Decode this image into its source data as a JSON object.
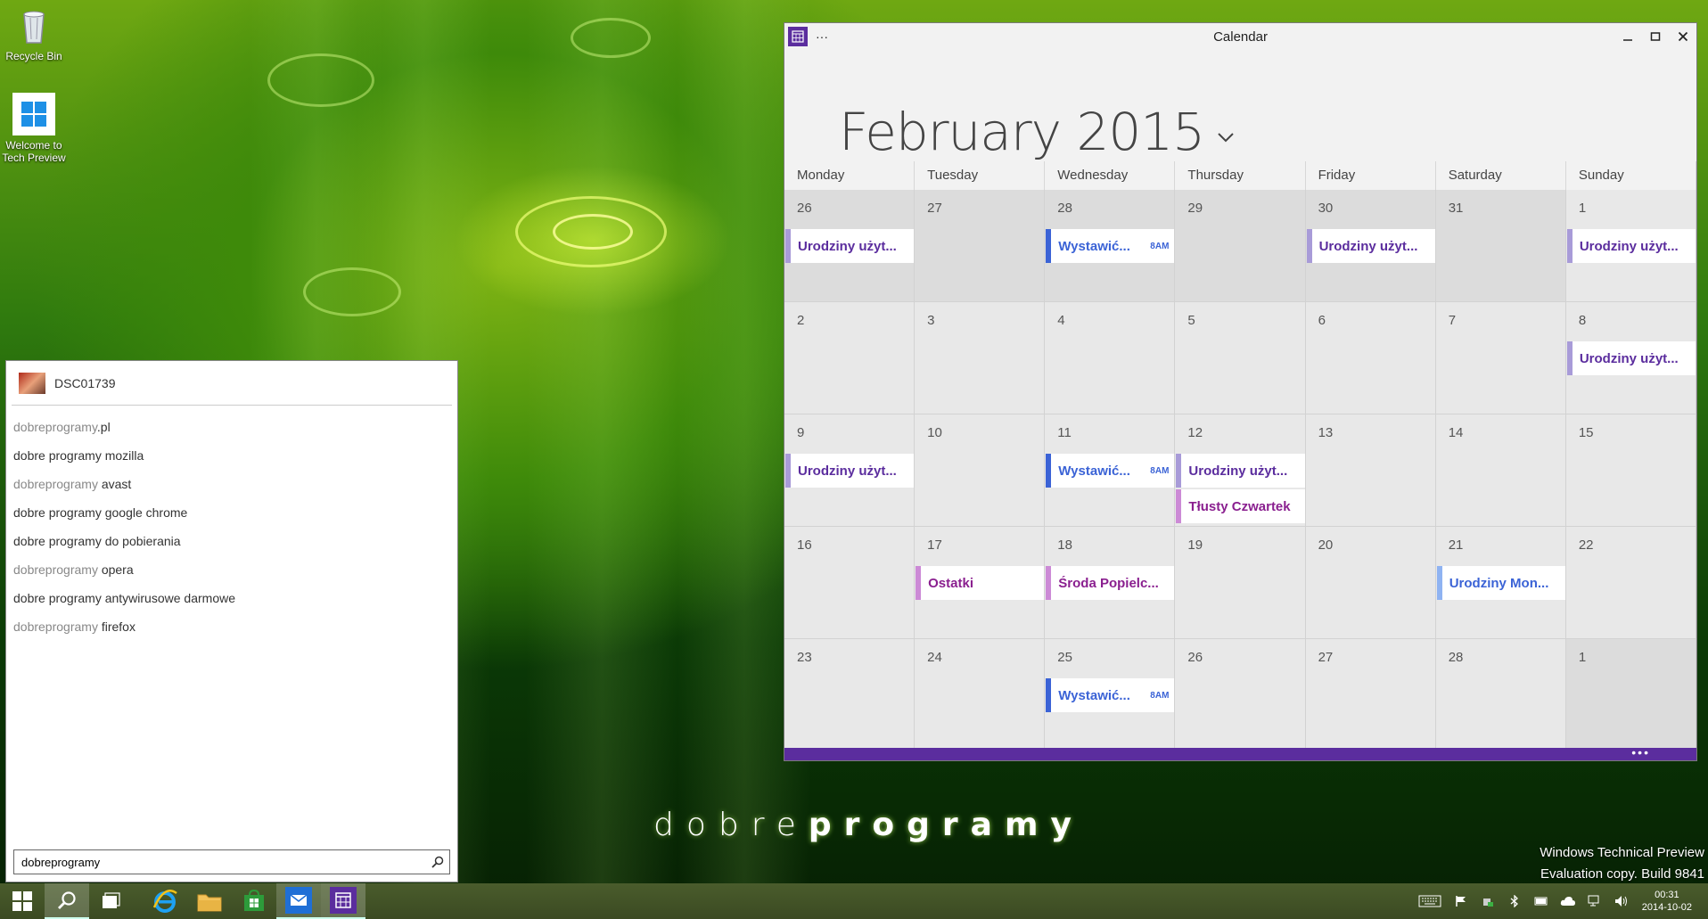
{
  "desktop": {
    "icons": [
      {
        "label": "Recycle Bin",
        "icon": "recycle-bin-icon"
      },
      {
        "label": "Welcome to Tech Preview",
        "icon": "windows-logo-icon"
      }
    ],
    "watermark": {
      "light": "dobre",
      "bold": "programy"
    },
    "build_info": {
      "line1": "Windows Technical Preview",
      "line2": "Evaluation copy. Build 9841"
    }
  },
  "search": {
    "top_result": {
      "label": "DSC01739",
      "icon": "photo-thumbnail"
    },
    "suggestions": [
      {
        "dim": "dobreprogramy",
        "text": ".pl"
      },
      {
        "dim": "",
        "text": "dobre programy mozilla"
      },
      {
        "dim": "dobreprogramy",
        "text": " avast"
      },
      {
        "dim": "",
        "text": "dobre programy google chrome"
      },
      {
        "dim": "",
        "text": "dobre programy do pobierania"
      },
      {
        "dim": "dobreprogramy",
        "text": " opera"
      },
      {
        "dim": "",
        "text": "dobre programy antywirusowe darmowe"
      },
      {
        "dim": "dobreprogramy",
        "text": " firefox"
      }
    ],
    "query": "dobreprogramy",
    "search_icon": "search-icon"
  },
  "calendar": {
    "window_title": "Calendar",
    "more_label": "···",
    "month_title": "February 2015",
    "days_of_week": [
      "Monday",
      "Tuesday",
      "Wednesday",
      "Thursday",
      "Friday",
      "Saturday",
      "Sunday"
    ],
    "weeks": [
      [
        {
          "day": "26",
          "other": true,
          "events": [
            {
              "label": "Urodziny użyt...",
              "type": "purple"
            }
          ]
        },
        {
          "day": "27",
          "other": true,
          "events": []
        },
        {
          "day": "28",
          "other": true,
          "events": [
            {
              "label": "Wystawić...",
              "time": "8AM",
              "type": "blue"
            }
          ]
        },
        {
          "day": "29",
          "other": true,
          "events": []
        },
        {
          "day": "30",
          "other": true,
          "events": [
            {
              "label": "Urodziny użyt...",
              "type": "purple"
            }
          ]
        },
        {
          "day": "31",
          "other": true,
          "events": []
        },
        {
          "day": "1",
          "other": false,
          "events": [
            {
              "label": "Urodziny użyt...",
              "type": "purple"
            }
          ]
        }
      ],
      [
        {
          "day": "2",
          "other": false,
          "events": []
        },
        {
          "day": "3",
          "other": false,
          "events": []
        },
        {
          "day": "4",
          "other": false,
          "events": []
        },
        {
          "day": "5",
          "other": false,
          "events": []
        },
        {
          "day": "6",
          "other": false,
          "events": []
        },
        {
          "day": "7",
          "other": false,
          "events": []
        },
        {
          "day": "8",
          "other": false,
          "events": [
            {
              "label": "Urodziny użyt...",
              "type": "purple"
            }
          ]
        }
      ],
      [
        {
          "day": "9",
          "other": false,
          "events": [
            {
              "label": "Urodziny użyt...",
              "type": "purple"
            }
          ]
        },
        {
          "day": "10",
          "other": false,
          "events": []
        },
        {
          "day": "11",
          "other": false,
          "events": [
            {
              "label": "Wystawić...",
              "time": "8AM",
              "type": "blue"
            }
          ]
        },
        {
          "day": "12",
          "other": false,
          "events": [
            {
              "label": "Urodziny użyt...",
              "type": "purple"
            },
            {
              "label": "Tłusty Czwartek",
              "type": "pink"
            }
          ]
        },
        {
          "day": "13",
          "other": false,
          "events": []
        },
        {
          "day": "14",
          "other": false,
          "events": []
        },
        {
          "day": "15",
          "other": false,
          "events": []
        }
      ],
      [
        {
          "day": "16",
          "other": false,
          "events": []
        },
        {
          "day": "17",
          "other": false,
          "events": [
            {
              "label": "Ostatki",
              "type": "pink"
            }
          ]
        },
        {
          "day": "18",
          "other": false,
          "events": [
            {
              "label": "Środa Popielc...",
              "type": "pink"
            }
          ]
        },
        {
          "day": "19",
          "other": false,
          "events": []
        },
        {
          "day": "20",
          "other": false,
          "events": []
        },
        {
          "day": "21",
          "other": false,
          "events": [
            {
              "label": "Urodziny Mon...",
              "type": "lb"
            }
          ]
        },
        {
          "day": "22",
          "other": false,
          "events": []
        }
      ],
      [
        {
          "day": "23",
          "other": false,
          "events": []
        },
        {
          "day": "24",
          "other": false,
          "events": []
        },
        {
          "day": "25",
          "other": false,
          "events": [
            {
              "label": "Wystawić...",
              "time": "8AM",
              "type": "blue"
            }
          ]
        },
        {
          "day": "26",
          "other": false,
          "events": []
        },
        {
          "day": "27",
          "other": false,
          "events": []
        },
        {
          "day": "28",
          "other": false,
          "events": []
        },
        {
          "day": "1",
          "other": true,
          "events": []
        }
      ]
    ],
    "appbar_more": "•••"
  },
  "taskbar": {
    "items": [
      {
        "name": "start-button",
        "icon": "windows-logo-icon"
      },
      {
        "name": "search-taskbar-button",
        "icon": "search-icon"
      },
      {
        "name": "task-view-button",
        "icon": "task-view-icon"
      },
      {
        "name": "internet-explorer-button",
        "icon": "ie-icon"
      },
      {
        "name": "file-explorer-button",
        "icon": "folder-icon"
      },
      {
        "name": "store-button",
        "icon": "store-icon"
      },
      {
        "name": "mail-button",
        "icon": "mail-icon"
      },
      {
        "name": "calendar-button",
        "icon": "calendar-icon"
      }
    ],
    "tray": [
      "keyboard-icon",
      "flag-icon",
      "network-shield-icon",
      "bluetooth-icon",
      "battery-icon",
      "cloud-icon",
      "network-icon",
      "volume-icon"
    ],
    "clock": {
      "time": "00:31",
      "date": "2014-10-02"
    }
  },
  "colors": {
    "calendar_accent": "#5b2d9e",
    "event_blue": "#3b63d6",
    "event_pink": "#8a1f8f",
    "taskbar": "#3b4a22"
  }
}
